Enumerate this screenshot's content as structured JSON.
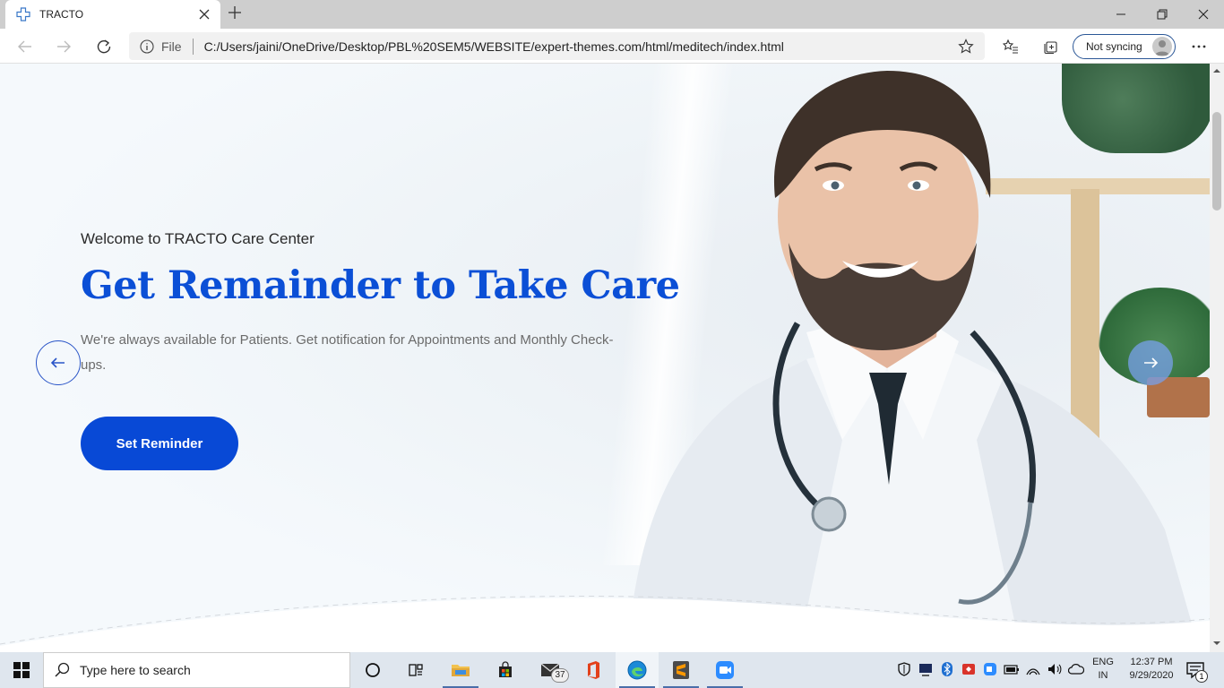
{
  "browser": {
    "tab_title": "TRACTO",
    "address": {
      "scheme_label": "File",
      "url": "C:/Users/jaini/OneDrive/Desktop/PBL%20SEM5/WEBSITE/expert-themes.com/html/meditech/index.html"
    },
    "sync_label": "Not syncing"
  },
  "hero": {
    "welcome": "Welcome to TRACTO Care Center",
    "headline": "Get Remainder to Take Care",
    "description": "We're always available for Patients. Get notification for Appointments and Monthly Check-ups.",
    "cta_label": "Set Reminder"
  },
  "taskbar": {
    "search_placeholder": "Type here to search",
    "mail_badge": "37",
    "lang_line1": "ENG",
    "lang_line2": "IN",
    "time": "12:37 PM",
    "date": "9/29/2020",
    "notification_count": "1"
  },
  "colors": {
    "accent": "#0b4fd6",
    "button": "#0849d6",
    "text_muted": "#6b6b6b"
  }
}
